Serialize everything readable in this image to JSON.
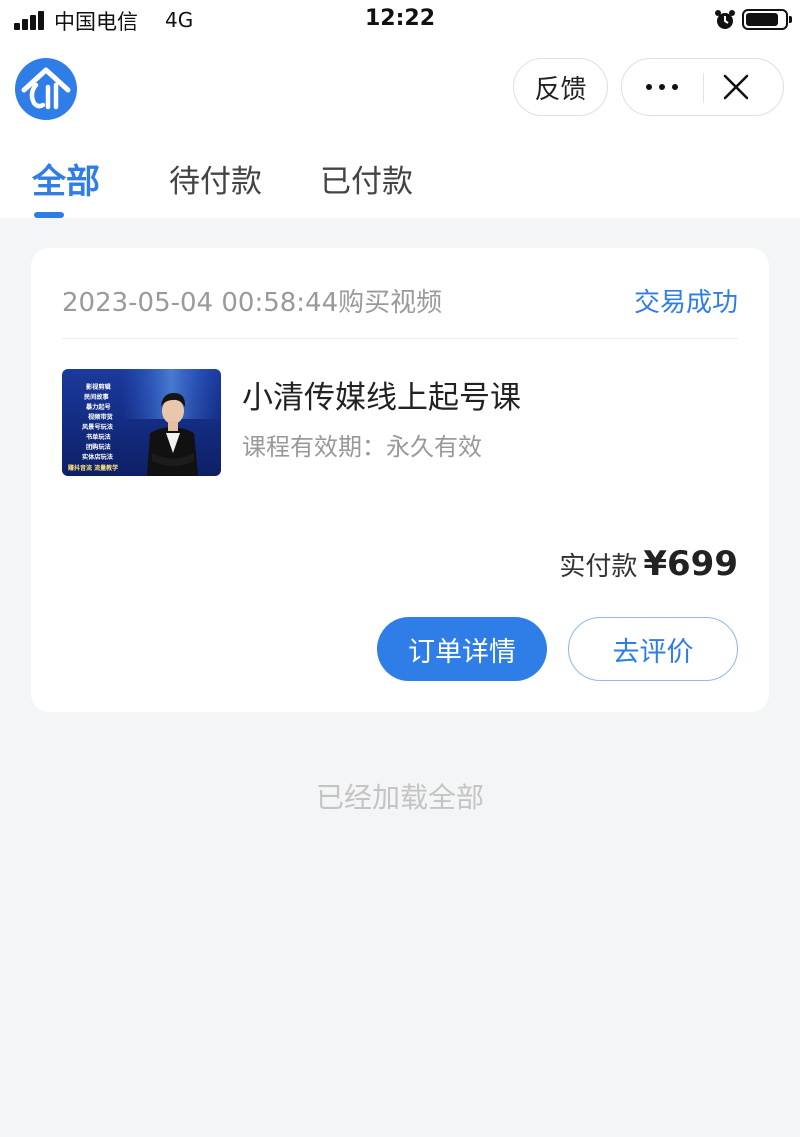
{
  "status_bar": {
    "carrier": "中国电信",
    "network": "4G",
    "time": "12:22"
  },
  "header": {
    "logo_icon": "house-logo-icon",
    "feedback_label": "反馈",
    "more_icon": "more-dots-icon",
    "close_icon": "close-icon"
  },
  "tabs": [
    {
      "label": "全部",
      "active": true
    },
    {
      "label": "待付款",
      "active": false
    },
    {
      "label": "已付款",
      "active": false
    }
  ],
  "order": {
    "datetime": "2023-05-04 00:58:44",
    "action": "购买视频",
    "status": "交易成功",
    "course_title": "小清传媒线上起号课",
    "validity_label": "课程有效期：",
    "validity_value": "永久有效",
    "thumbnail_lines": [
      "影视剪辑",
      "民间故事",
      "暴力起号",
      "视频带货",
      "风景号玩法",
      "书单玩法",
      "团购玩法",
      "实体店玩法"
    ],
    "thumbnail_footer": "赚抖音流 流量教学",
    "paid_label": "实付款",
    "paid_amount": "¥699",
    "detail_button": "订单详情",
    "review_button": "去评价"
  },
  "footer_note": "已经加载全部",
  "colors": {
    "accent": "#2f7ee8",
    "background": "#f4f5f6",
    "card": "#ffffff"
  }
}
